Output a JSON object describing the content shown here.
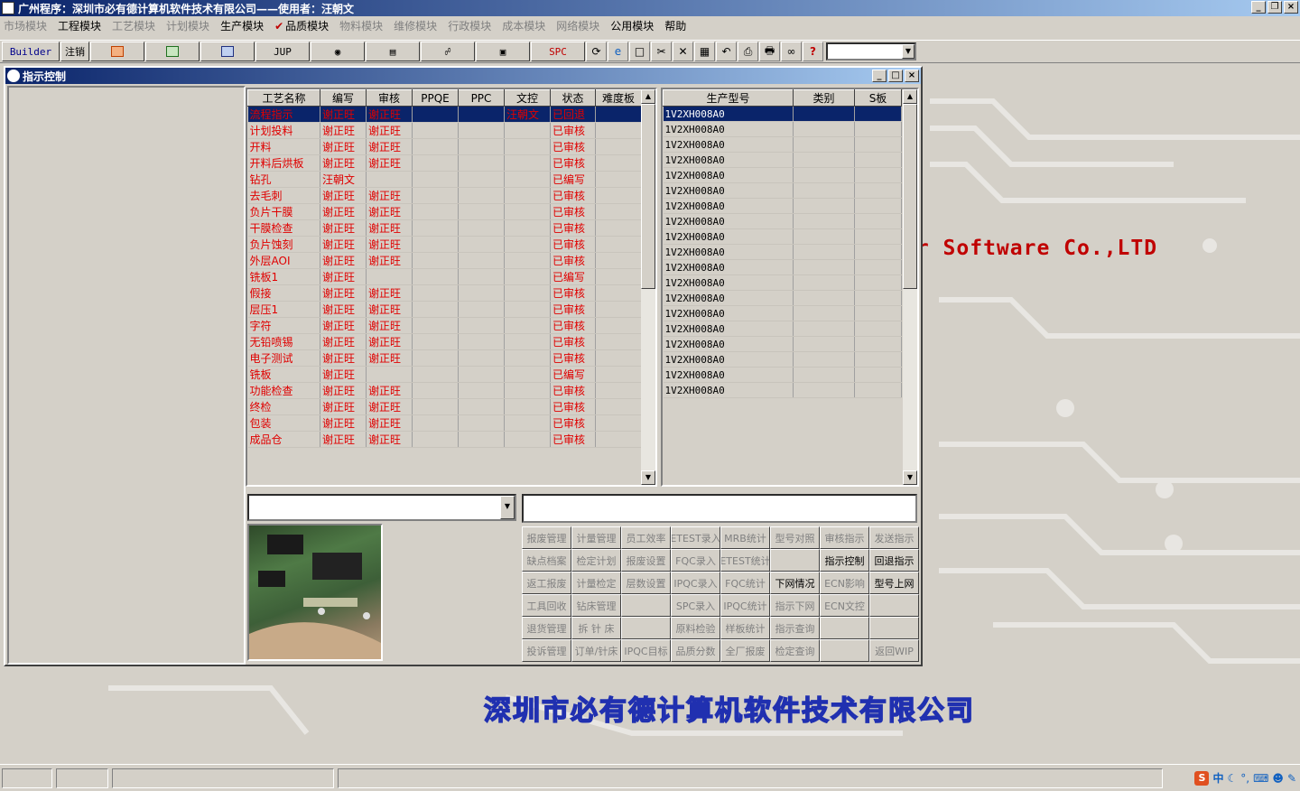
{
  "window": {
    "title": "广州程序：深圳市必有德计算机软件技术有限公司——使用者：汪朝文"
  },
  "menu": [
    {
      "label": "市场模块",
      "enabled": false
    },
    {
      "label": "工程模块",
      "enabled": true
    },
    {
      "label": "工艺模块",
      "enabled": false
    },
    {
      "label": "计划模块",
      "enabled": false
    },
    {
      "label": "生产模块",
      "enabled": true
    },
    {
      "label": "品质模块",
      "enabled": true,
      "checked": true
    },
    {
      "label": "物料模块",
      "enabled": false
    },
    {
      "label": "维修模块",
      "enabled": false
    },
    {
      "label": "行政模块",
      "enabled": false
    },
    {
      "label": "成本模块",
      "enabled": false
    },
    {
      "label": "网络模块",
      "enabled": false
    },
    {
      "label": "公用模块",
      "enabled": true
    },
    {
      "label": "帮助",
      "enabled": true
    }
  ],
  "toolbar": {
    "builder": "Builder",
    "logout": "注销",
    "jup": "JUP",
    "spc": "SPC"
  },
  "background": {
    "english_text": "er Software Co.,LTD",
    "chinese_text": "深圳市必有德计算机软件技术有限公司"
  },
  "child_window": {
    "title": "指示控制"
  },
  "process_table": {
    "columns": [
      "工艺名称",
      "编写",
      "审核",
      "PPQE",
      "PPC",
      "文控",
      "状态",
      "难度板"
    ],
    "rows": [
      [
        "流程指示",
        "谢正旺",
        "谢正旺",
        "",
        "",
        "汪朝文",
        "已回退",
        ""
      ],
      [
        "计划投料",
        "谢正旺",
        "谢正旺",
        "",
        "",
        "",
        "已审核",
        ""
      ],
      [
        "开料",
        "谢正旺",
        "谢正旺",
        "",
        "",
        "",
        "已审核",
        ""
      ],
      [
        "开料后烘板",
        "谢正旺",
        "谢正旺",
        "",
        "",
        "",
        "已审核",
        ""
      ],
      [
        "钻孔",
        "汪朝文",
        "",
        "",
        "",
        "",
        "已编写",
        ""
      ],
      [
        "去毛刺",
        "谢正旺",
        "谢正旺",
        "",
        "",
        "",
        "已审核",
        ""
      ],
      [
        "负片干膜",
        "谢正旺",
        "谢正旺",
        "",
        "",
        "",
        "已审核",
        ""
      ],
      [
        "干膜检查",
        "谢正旺",
        "谢正旺",
        "",
        "",
        "",
        "已审核",
        ""
      ],
      [
        "负片蚀刻",
        "谢正旺",
        "谢正旺",
        "",
        "",
        "",
        "已审核",
        ""
      ],
      [
        "外层AOI",
        "谢正旺",
        "谢正旺",
        "",
        "",
        "",
        "已审核",
        ""
      ],
      [
        "铣板1",
        "谢正旺",
        "",
        "",
        "",
        "",
        "已编写",
        ""
      ],
      [
        "假接",
        "谢正旺",
        "谢正旺",
        "",
        "",
        "",
        "已审核",
        ""
      ],
      [
        "层压1",
        "谢正旺",
        "谢正旺",
        "",
        "",
        "",
        "已审核",
        ""
      ],
      [
        "字符",
        "谢正旺",
        "谢正旺",
        "",
        "",
        "",
        "已审核",
        ""
      ],
      [
        "无铅喷锡",
        "谢正旺",
        "谢正旺",
        "",
        "",
        "",
        "已审核",
        ""
      ],
      [
        "电子测试",
        "谢正旺",
        "谢正旺",
        "",
        "",
        "",
        "已审核",
        ""
      ],
      [
        "铣板",
        "谢正旺",
        "",
        "",
        "",
        "",
        "已编写",
        ""
      ],
      [
        "功能检查",
        "谢正旺",
        "谢正旺",
        "",
        "",
        "",
        "已审核",
        ""
      ],
      [
        "终检",
        "谢正旺",
        "谢正旺",
        "",
        "",
        "",
        "已审核",
        ""
      ],
      [
        "包装",
        "谢正旺",
        "谢正旺",
        "",
        "",
        "",
        "已审核",
        ""
      ],
      [
        "成品仓",
        "谢正旺",
        "谢正旺",
        "",
        "",
        "",
        "已审核",
        ""
      ]
    ]
  },
  "model_table": {
    "columns": [
      "生产型号",
      "类别",
      "S板"
    ],
    "rows": [
      [
        "1V2XH008A0",
        "",
        ""
      ],
      [
        "1V2XH008A0",
        "",
        ""
      ],
      [
        "1V2XH008A0",
        "",
        ""
      ],
      [
        "1V2XH008A0",
        "",
        ""
      ],
      [
        "1V2XH008A0",
        "",
        ""
      ],
      [
        "1V2XH008A0",
        "",
        ""
      ],
      [
        "1V2XH008A0",
        "",
        ""
      ],
      [
        "1V2XH008A0",
        "",
        ""
      ],
      [
        "1V2XH008A0",
        "",
        ""
      ],
      [
        "1V2XH008A0",
        "",
        ""
      ],
      [
        "1V2XH008A0",
        "",
        ""
      ],
      [
        "1V2XH008A0",
        "",
        ""
      ],
      [
        "1V2XH008A0",
        "",
        ""
      ],
      [
        "1V2XH008A0",
        "",
        ""
      ],
      [
        "1V2XH008A0",
        "",
        ""
      ],
      [
        "1V2XH008A0",
        "",
        ""
      ],
      [
        "1V2XH008A0",
        "",
        ""
      ],
      [
        "1V2XH008A0",
        "",
        ""
      ],
      [
        "1V2XH008A0",
        "",
        ""
      ]
    ]
  },
  "buttons": [
    {
      "label": "报废管理",
      "enabled": false
    },
    {
      "label": "计量管理",
      "enabled": false
    },
    {
      "label": "员工效率",
      "enabled": false
    },
    {
      "label": "ETEST录入",
      "enabled": false
    },
    {
      "label": "MRB统计",
      "enabled": false
    },
    {
      "label": "型号对照",
      "enabled": false
    },
    {
      "label": "审核指示",
      "enabled": false
    },
    {
      "label": "发送指示",
      "enabled": false
    },
    {
      "label": "缺点档案",
      "enabled": false
    },
    {
      "label": "检定计划",
      "enabled": false
    },
    {
      "label": "报废设置",
      "enabled": false
    },
    {
      "label": "FQC录入",
      "enabled": false
    },
    {
      "label": "ETEST统计",
      "enabled": false
    },
    {
      "label": "",
      "enabled": false
    },
    {
      "label": "指示控制",
      "enabled": true
    },
    {
      "label": "回退指示",
      "enabled": true
    },
    {
      "label": "返工报废",
      "enabled": false
    },
    {
      "label": "计量检定",
      "enabled": false
    },
    {
      "label": "层数设置",
      "enabled": false
    },
    {
      "label": "IPQC录入",
      "enabled": false
    },
    {
      "label": "FQC统计",
      "enabled": false
    },
    {
      "label": "下网情况",
      "enabled": true
    },
    {
      "label": "ECN影响",
      "enabled": false
    },
    {
      "label": "型号上网",
      "enabled": true
    },
    {
      "label": "工具回收",
      "enabled": false
    },
    {
      "label": "钻床管理",
      "enabled": false
    },
    {
      "label": "",
      "enabled": false
    },
    {
      "label": "SPC录入",
      "enabled": false
    },
    {
      "label": "IPQC统计",
      "enabled": false
    },
    {
      "label": "指示下网",
      "enabled": false
    },
    {
      "label": "ECN文控",
      "enabled": false
    },
    {
      "label": "",
      "enabled": false
    },
    {
      "label": "退货管理",
      "enabled": false
    },
    {
      "label": "拆 针 床",
      "enabled": false
    },
    {
      "label": "",
      "enabled": false
    },
    {
      "label": "原料检验",
      "enabled": false
    },
    {
      "label": "样板统计",
      "enabled": false
    },
    {
      "label": "指示查询",
      "enabled": false
    },
    {
      "label": "",
      "enabled": false
    },
    {
      "label": "",
      "enabled": false
    },
    {
      "label": "投诉管理",
      "enabled": false
    },
    {
      "label": "订单/针床",
      "enabled": false
    },
    {
      "label": "IPQC目标",
      "enabled": false
    },
    {
      "label": "品质分数",
      "enabled": false
    },
    {
      "label": "全厂报废",
      "enabled": false
    },
    {
      "label": "检定查询",
      "enabled": false
    },
    {
      "label": "",
      "enabled": false
    },
    {
      "label": "返回WIP",
      "enabled": false
    }
  ],
  "tray": {
    "ime": "中"
  }
}
